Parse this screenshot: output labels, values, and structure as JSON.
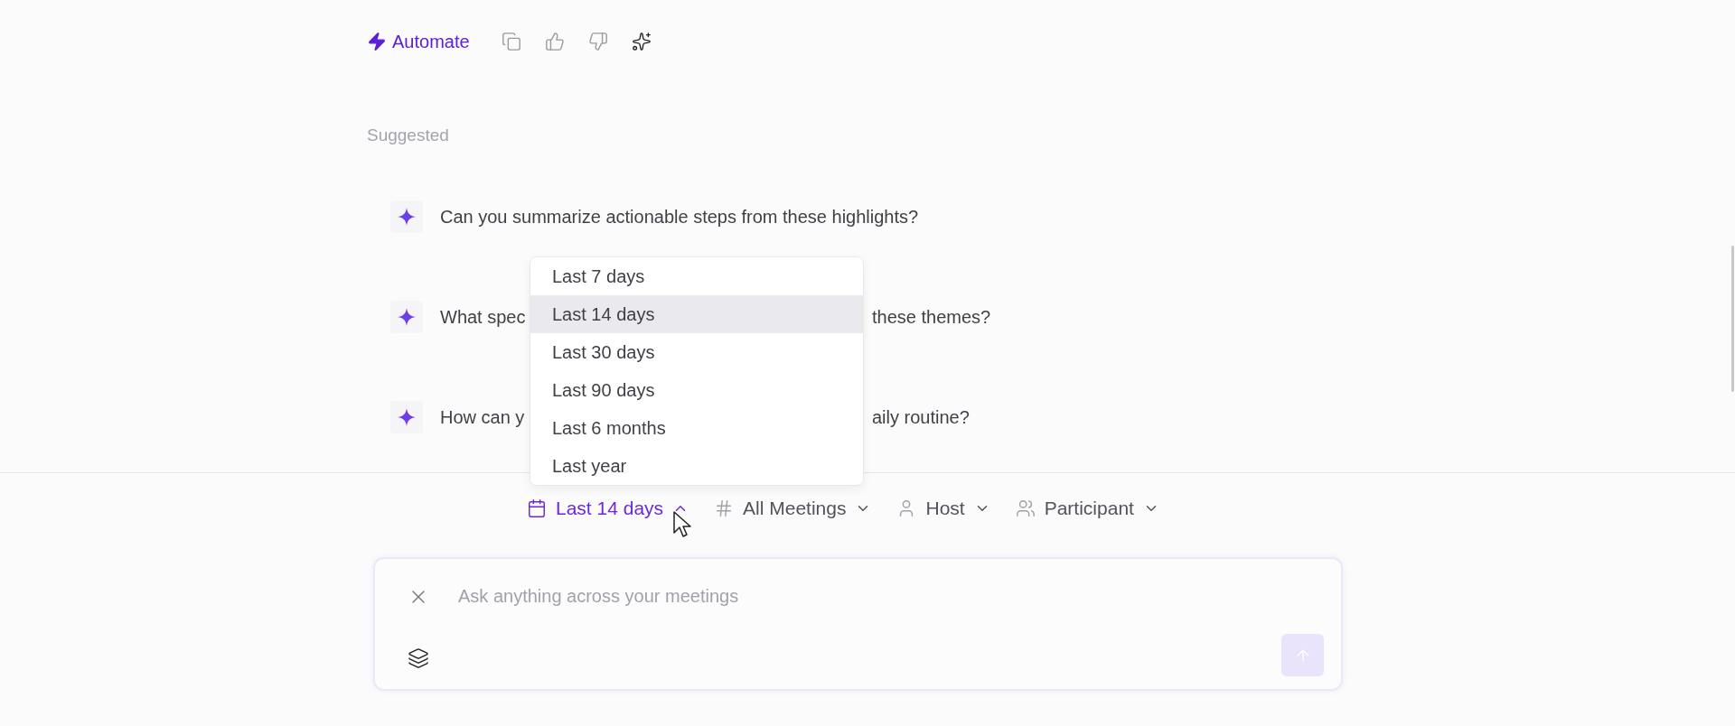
{
  "toolbar": {
    "automate_label": "Automate"
  },
  "suggested_heading": "Suggested",
  "suggestions": [
    {
      "text_start": "Can you summarize actionable steps from these highlights?"
    },
    {
      "text_start": "What spec",
      "text_end": "these themes?"
    },
    {
      "text_start": "How can y",
      "text_end": "aily routine?"
    }
  ],
  "date_menu": {
    "items": [
      {
        "label": "Last 7 days",
        "selected": false
      },
      {
        "label": "Last 14 days",
        "selected": true
      },
      {
        "label": "Last 30 days",
        "selected": false
      },
      {
        "label": "Last 90 days",
        "selected": false
      },
      {
        "label": "Last 6 months",
        "selected": false
      },
      {
        "label": "Last year",
        "selected": false
      }
    ]
  },
  "filters": [
    {
      "kind": "date",
      "label": "Last 14 days",
      "open": true
    },
    {
      "kind": "tag",
      "label": "All Meetings",
      "open": false
    },
    {
      "kind": "person",
      "label": "Host",
      "open": false
    },
    {
      "kind": "people",
      "label": "Participant",
      "open": false
    }
  ],
  "composer": {
    "placeholder": "Ask anything across your meetings"
  }
}
